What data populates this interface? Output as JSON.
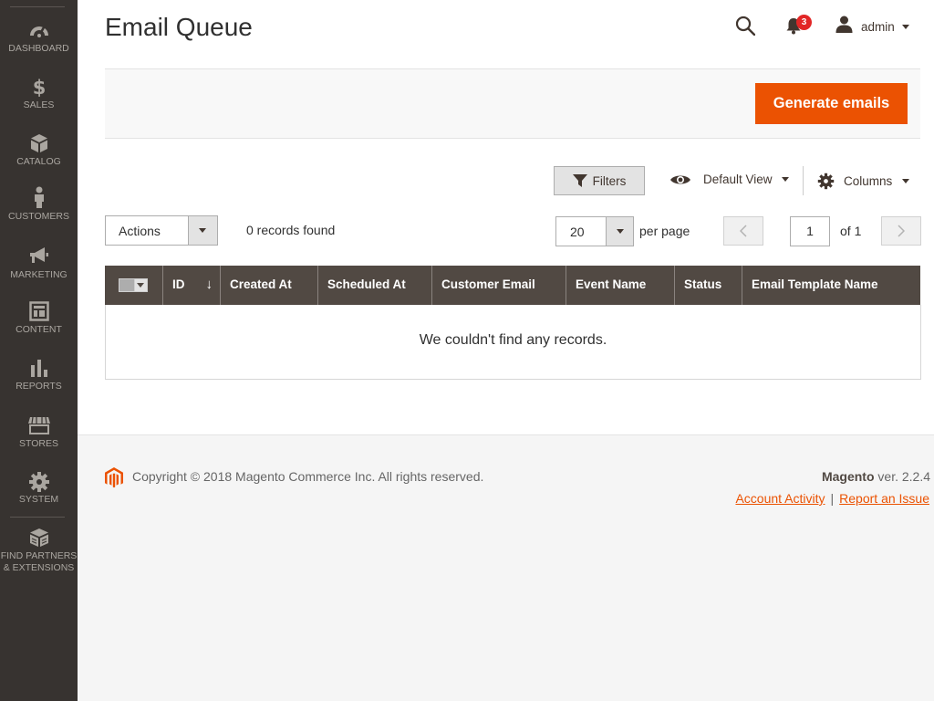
{
  "sidebar": {
    "items": [
      {
        "label": "DASHBOARD",
        "icon": "dashboard-icon"
      },
      {
        "label": "SALES",
        "icon": "dollar-icon"
      },
      {
        "label": "CATALOG",
        "icon": "box-icon"
      },
      {
        "label": "CUSTOMERS",
        "icon": "person-icon"
      },
      {
        "label": "MARKETING",
        "icon": "megaphone-icon"
      },
      {
        "label": "CONTENT",
        "icon": "layout-icon"
      },
      {
        "label": "REPORTS",
        "icon": "bar-chart-icon"
      },
      {
        "label": "STORES",
        "icon": "storefront-icon"
      },
      {
        "label": "SYSTEM",
        "icon": "gear-icon"
      },
      {
        "label_line1": "FIND PARTNERS",
        "label_line2": "& EXTENSIONS",
        "icon": "partners-box-icon"
      }
    ]
  },
  "header": {
    "title": "Email Queue",
    "notification_count": "3",
    "user_name": "admin"
  },
  "action_bar": {
    "generate_label": "Generate emails"
  },
  "toolbar": {
    "filters_label": "Filters",
    "view_label": "Default View",
    "columns_label": "Columns",
    "actions_label": "Actions",
    "records_found": "0 records found",
    "per_page_value": "20",
    "per_page_label": "per page",
    "current_page": "1",
    "of_pages": "of 1"
  },
  "grid": {
    "columns": [
      "ID",
      "Created At",
      "Scheduled At",
      "Customer Email",
      "Event Name",
      "Status",
      "Email Template Name"
    ],
    "sort_indicator": "↓",
    "empty_message": "We couldn't find any records."
  },
  "footer": {
    "copyright": "Copyright © 2018 Magento Commerce Inc. All rights reserved.",
    "brand": "Magento",
    "version": " ver. 2.2.4",
    "link_activity": "Account Activity",
    "separator": "|",
    "link_issue": "Report an Issue"
  },
  "colors": {
    "accent": "#eb5202",
    "sidebar_bg": "#373330",
    "grid_header_bg": "#514943",
    "badge": "#e22626"
  }
}
